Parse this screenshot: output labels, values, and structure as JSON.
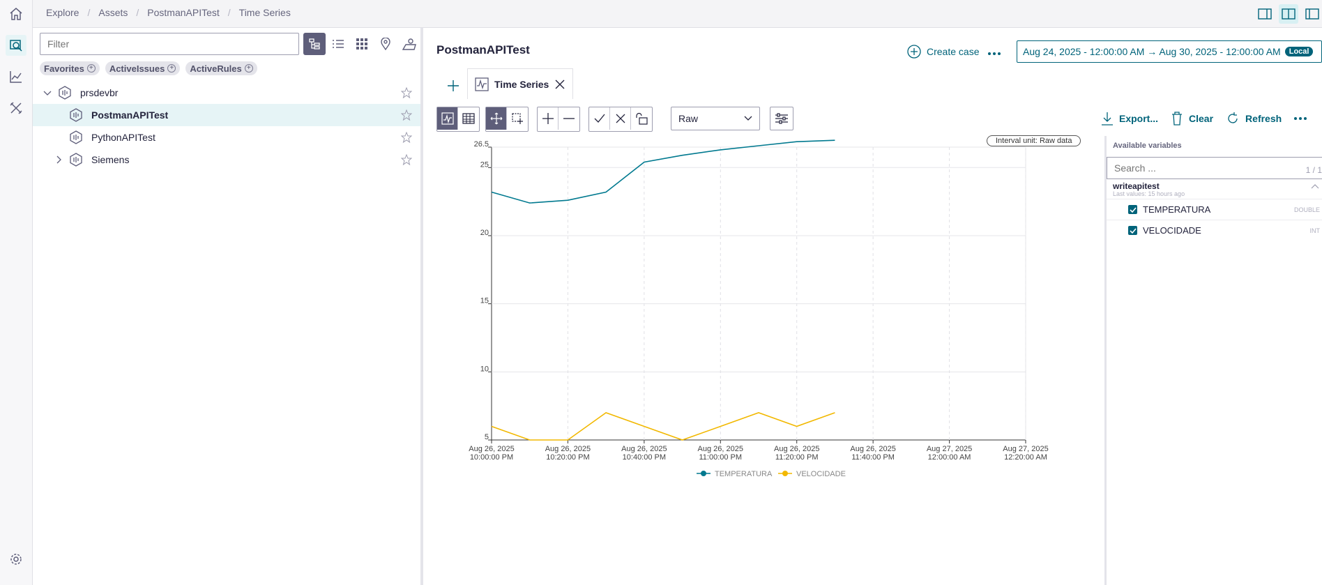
{
  "breadcrumb": [
    "Explore",
    "Assets",
    "PostmanAPITest",
    "Time Series"
  ],
  "filter": {
    "placeholder": "Filter"
  },
  "chips": [
    "Favorites",
    "ActiveIssues",
    "ActiveRules"
  ],
  "tree": [
    {
      "label": "prsdevbr"
    },
    {
      "label": "PostmanAPITest"
    },
    {
      "label": "PythonAPITest"
    },
    {
      "label": "Siemens"
    }
  ],
  "main": {
    "title": "PostmanAPITest",
    "create_case": "Create case",
    "date_range": "Aug 24, 2025 - 12:00:00 AM → Aug 30, 2025 - 12:00:00 AM",
    "tz_badge": "Local",
    "tab_label": "Time Series",
    "mode_select": "Raw",
    "export": "Export...",
    "clear": "Clear",
    "refresh": "Refresh",
    "interval_unit": "Interval unit: Raw data"
  },
  "variables": {
    "header": "Available variables",
    "search_placeholder": "Search ...",
    "count": "1 / 1",
    "group": "writeapitest",
    "group_sub": "Last values: 15 hours ago",
    "items": [
      {
        "name": "TEMPERATURA",
        "type": "DOUBLE"
      },
      {
        "name": "VELOCIDADE",
        "type": "INT"
      }
    ]
  },
  "chart_data": {
    "type": "line",
    "y_ticks": [
      "5",
      "10",
      "15",
      "20",
      "25",
      "26.5"
    ],
    "ylim": [
      5,
      26.5
    ],
    "x_ticks": [
      [
        "Aug 26, 2025",
        "10:00:00 PM"
      ],
      [
        "Aug 26, 2025",
        "10:20:00 PM"
      ],
      [
        "Aug 26, 2025",
        "10:40:00 PM"
      ],
      [
        "Aug 26, 2025",
        "11:00:00 PM"
      ],
      [
        "Aug 26, 2025",
        "11:20:00 PM"
      ],
      [
        "Aug 26, 2025",
        "11:40:00 PM"
      ],
      [
        "Aug 27, 2025",
        "12:00:00 AM"
      ],
      [
        "Aug 27, 2025",
        "12:20:00 AM"
      ]
    ],
    "x_minutes_range": [
      0,
      140
    ],
    "series": [
      {
        "name": "TEMPERATURA",
        "color": "#00798f",
        "x_minutes": [
          0,
          10,
          20,
          30,
          40,
          50,
          60,
          70,
          80,
          90
        ],
        "values": [
          23.2,
          22.4,
          22.6,
          23.2,
          25.4,
          25.9,
          26.3,
          26.6,
          26.9,
          27.3
        ]
      },
      {
        "name": "VELOCIDADE",
        "color": "#f2b800",
        "x_minutes": [
          0,
          10,
          20,
          30,
          40,
          50,
          60,
          70,
          80,
          90
        ],
        "values": [
          6,
          5,
          5,
          7,
          6,
          5,
          6,
          7,
          6,
          7
        ]
      }
    ]
  }
}
